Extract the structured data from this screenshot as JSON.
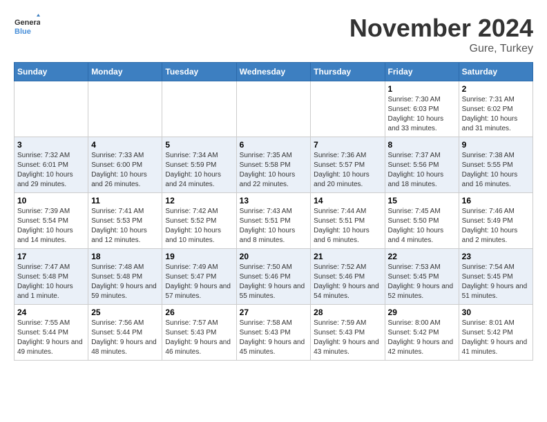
{
  "logo": {
    "general": "General",
    "blue": "Blue"
  },
  "title": "November 2024",
  "location": "Gure, Turkey",
  "headers": [
    "Sunday",
    "Monday",
    "Tuesday",
    "Wednesday",
    "Thursday",
    "Friday",
    "Saturday"
  ],
  "weeks": [
    [
      {
        "day": "",
        "info": ""
      },
      {
        "day": "",
        "info": ""
      },
      {
        "day": "",
        "info": ""
      },
      {
        "day": "",
        "info": ""
      },
      {
        "day": "",
        "info": ""
      },
      {
        "day": "1",
        "info": "Sunrise: 7:30 AM\nSunset: 6:03 PM\nDaylight: 10 hours and 33 minutes."
      },
      {
        "day": "2",
        "info": "Sunrise: 7:31 AM\nSunset: 6:02 PM\nDaylight: 10 hours and 31 minutes."
      }
    ],
    [
      {
        "day": "3",
        "info": "Sunrise: 7:32 AM\nSunset: 6:01 PM\nDaylight: 10 hours and 29 minutes."
      },
      {
        "day": "4",
        "info": "Sunrise: 7:33 AM\nSunset: 6:00 PM\nDaylight: 10 hours and 26 minutes."
      },
      {
        "day": "5",
        "info": "Sunrise: 7:34 AM\nSunset: 5:59 PM\nDaylight: 10 hours and 24 minutes."
      },
      {
        "day": "6",
        "info": "Sunrise: 7:35 AM\nSunset: 5:58 PM\nDaylight: 10 hours and 22 minutes."
      },
      {
        "day": "7",
        "info": "Sunrise: 7:36 AM\nSunset: 5:57 PM\nDaylight: 10 hours and 20 minutes."
      },
      {
        "day": "8",
        "info": "Sunrise: 7:37 AM\nSunset: 5:56 PM\nDaylight: 10 hours and 18 minutes."
      },
      {
        "day": "9",
        "info": "Sunrise: 7:38 AM\nSunset: 5:55 PM\nDaylight: 10 hours and 16 minutes."
      }
    ],
    [
      {
        "day": "10",
        "info": "Sunrise: 7:39 AM\nSunset: 5:54 PM\nDaylight: 10 hours and 14 minutes."
      },
      {
        "day": "11",
        "info": "Sunrise: 7:41 AM\nSunset: 5:53 PM\nDaylight: 10 hours and 12 minutes."
      },
      {
        "day": "12",
        "info": "Sunrise: 7:42 AM\nSunset: 5:52 PM\nDaylight: 10 hours and 10 minutes."
      },
      {
        "day": "13",
        "info": "Sunrise: 7:43 AM\nSunset: 5:51 PM\nDaylight: 10 hours and 8 minutes."
      },
      {
        "day": "14",
        "info": "Sunrise: 7:44 AM\nSunset: 5:51 PM\nDaylight: 10 hours and 6 minutes."
      },
      {
        "day": "15",
        "info": "Sunrise: 7:45 AM\nSunset: 5:50 PM\nDaylight: 10 hours and 4 minutes."
      },
      {
        "day": "16",
        "info": "Sunrise: 7:46 AM\nSunset: 5:49 PM\nDaylight: 10 hours and 2 minutes."
      }
    ],
    [
      {
        "day": "17",
        "info": "Sunrise: 7:47 AM\nSunset: 5:48 PM\nDaylight: 10 hours and 1 minute."
      },
      {
        "day": "18",
        "info": "Sunrise: 7:48 AM\nSunset: 5:48 PM\nDaylight: 9 hours and 59 minutes."
      },
      {
        "day": "19",
        "info": "Sunrise: 7:49 AM\nSunset: 5:47 PM\nDaylight: 9 hours and 57 minutes."
      },
      {
        "day": "20",
        "info": "Sunrise: 7:50 AM\nSunset: 5:46 PM\nDaylight: 9 hours and 55 minutes."
      },
      {
        "day": "21",
        "info": "Sunrise: 7:52 AM\nSunset: 5:46 PM\nDaylight: 9 hours and 54 minutes."
      },
      {
        "day": "22",
        "info": "Sunrise: 7:53 AM\nSunset: 5:45 PM\nDaylight: 9 hours and 52 minutes."
      },
      {
        "day": "23",
        "info": "Sunrise: 7:54 AM\nSunset: 5:45 PM\nDaylight: 9 hours and 51 minutes."
      }
    ],
    [
      {
        "day": "24",
        "info": "Sunrise: 7:55 AM\nSunset: 5:44 PM\nDaylight: 9 hours and 49 minutes."
      },
      {
        "day": "25",
        "info": "Sunrise: 7:56 AM\nSunset: 5:44 PM\nDaylight: 9 hours and 48 minutes."
      },
      {
        "day": "26",
        "info": "Sunrise: 7:57 AM\nSunset: 5:43 PM\nDaylight: 9 hours and 46 minutes."
      },
      {
        "day": "27",
        "info": "Sunrise: 7:58 AM\nSunset: 5:43 PM\nDaylight: 9 hours and 45 minutes."
      },
      {
        "day": "28",
        "info": "Sunrise: 7:59 AM\nSunset: 5:43 PM\nDaylight: 9 hours and 43 minutes."
      },
      {
        "day": "29",
        "info": "Sunrise: 8:00 AM\nSunset: 5:42 PM\nDaylight: 9 hours and 42 minutes."
      },
      {
        "day": "30",
        "info": "Sunrise: 8:01 AM\nSunset: 5:42 PM\nDaylight: 9 hours and 41 minutes."
      }
    ]
  ]
}
